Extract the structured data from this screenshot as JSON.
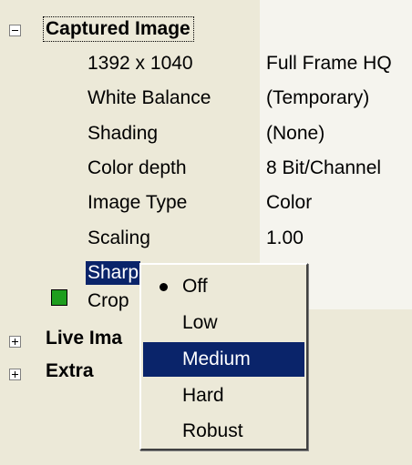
{
  "groups": {
    "captured_image": {
      "label": "Captured Image"
    },
    "live_image": {
      "label": "Live Ima"
    },
    "extra": {
      "label": "Extra"
    }
  },
  "properties": [
    {
      "name": "1392 x 1040",
      "value": "Full Frame HQ"
    },
    {
      "name": "White Balance",
      "value": "(Temporary)"
    },
    {
      "name": "Shading",
      "value": "(None)"
    },
    {
      "name": "Color depth",
      "value": "8 Bit/Channel"
    },
    {
      "name": "Image Type",
      "value": "Color"
    },
    {
      "name": "Scaling",
      "value": "1.00"
    },
    {
      "name": "Sharp",
      "value": ""
    },
    {
      "name": "Crop",
      "value": ""
    }
  ],
  "dropdown": {
    "items": [
      {
        "label": "Off",
        "checked": true
      },
      {
        "label": "Low"
      },
      {
        "label": "Medium",
        "highlighted": true
      },
      {
        "label": "Hard"
      },
      {
        "label": "Robust"
      }
    ]
  },
  "colors": {
    "selection": "#0a246a",
    "background": "#ece9d8",
    "crop_swatch": "#1e9e1e"
  },
  "icons": {
    "captured_image_expander": "minus-box-icon",
    "live_image_expander": "plus-box-icon",
    "extra_expander": "plus-box-icon",
    "checked_item": "bullet-icon"
  }
}
